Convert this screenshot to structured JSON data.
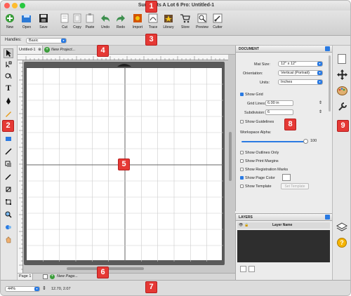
{
  "window": {
    "title": "Sure Cuts A Lot 6 Pro: Untitled-1"
  },
  "toolbar": {
    "buttons": [
      {
        "label": "New",
        "icon": "new-icon"
      },
      {
        "label": "Open",
        "icon": "open-icon"
      },
      {
        "label": "Save",
        "icon": "save-icon"
      },
      {
        "label": "Cut",
        "icon": "cut-icon"
      },
      {
        "label": "Copy",
        "icon": "copy-icon"
      },
      {
        "label": "Paste",
        "icon": "paste-icon"
      },
      {
        "label": "Undo",
        "icon": "undo-icon"
      },
      {
        "label": "Redo",
        "icon": "redo-icon"
      },
      {
        "label": "Import",
        "icon": "import-icon"
      },
      {
        "label": "Trace",
        "icon": "trace-icon"
      },
      {
        "label": "Library",
        "icon": "library-icon"
      },
      {
        "label": "Store",
        "icon": "store-icon"
      },
      {
        "label": "Preview",
        "icon": "preview-icon"
      },
      {
        "label": "Cutter",
        "icon": "cutter-icon"
      }
    ]
  },
  "options": {
    "handles_label": "Handles:",
    "handles_value": "Basic"
  },
  "tabs": {
    "doc_tab": "Untitled-1",
    "new_project": "New Project...",
    "page_tab": "Page 1",
    "new_page": "New Page..."
  },
  "status": {
    "zoom": "44%",
    "coords": "12.70, 2.07"
  },
  "document_panel": {
    "title": "DOCUMENT",
    "mat_size_label": "Mat Size:",
    "mat_size_value": "12\" x 12\"",
    "orientation_label": "Orientation:",
    "orientation_value": "Vertical (Portrait)",
    "units_label": "Units:",
    "units_value": "Inches",
    "show_grid": "Show Grid",
    "grid_lines_label": "Grid Lines:",
    "grid_lines_value": "6.00 in",
    "subdivision_label": "Subdivision:",
    "subdivision_value": "6",
    "show_guidelines": "Show Guidelines",
    "workspace_alpha_label": "Workspace Alpha:",
    "workspace_alpha_value": "100",
    "show_outlines": "Show Outlines Only",
    "show_print_margins": "Show Print Margins",
    "show_registration": "Show Registration Marks",
    "show_page_color": "Show Page Color",
    "show_template": "Show Template",
    "set_template": "Set Template"
  },
  "layers_panel": {
    "title": "LAYERS",
    "column_name": "Layer Name"
  },
  "callouts": [
    "1",
    "2",
    "3",
    "4",
    "5",
    "6",
    "7",
    "8",
    "9"
  ],
  "colors": {
    "callout": "#e53935",
    "accent": "#2a7ae2"
  }
}
